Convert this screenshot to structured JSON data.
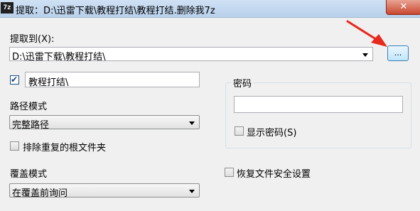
{
  "window": {
    "app_icon_text": "7z",
    "title": "提取：D:\\迅雷下载\\教程打结\\教程打结.删除我7z",
    "close_label": "✕"
  },
  "extract_to": {
    "label": "提取到(X):",
    "path_value": "D:\\迅雷下载\\教程打结\\",
    "browse_label": "..."
  },
  "folder_name": {
    "checked": true,
    "value": "教程打结\\"
  },
  "path_mode": {
    "label": "路径模式",
    "selected": "完整路径"
  },
  "eliminate_duplicate_root": {
    "label": "排除重复的根文件夹",
    "checked": false
  },
  "overwrite_mode": {
    "label": "覆盖模式",
    "selected": "在覆盖前询问"
  },
  "password": {
    "group_label": "密码",
    "value": "",
    "show_password_label": "显示密码(S)",
    "show_password_checked": false
  },
  "restore_security": {
    "label": "恢复文件安全设置",
    "checked": false
  },
  "colors": {
    "annotation_arrow": "#e8291c",
    "window_bg": "#f0f0f0",
    "titlebar": "#c5d9f0"
  }
}
